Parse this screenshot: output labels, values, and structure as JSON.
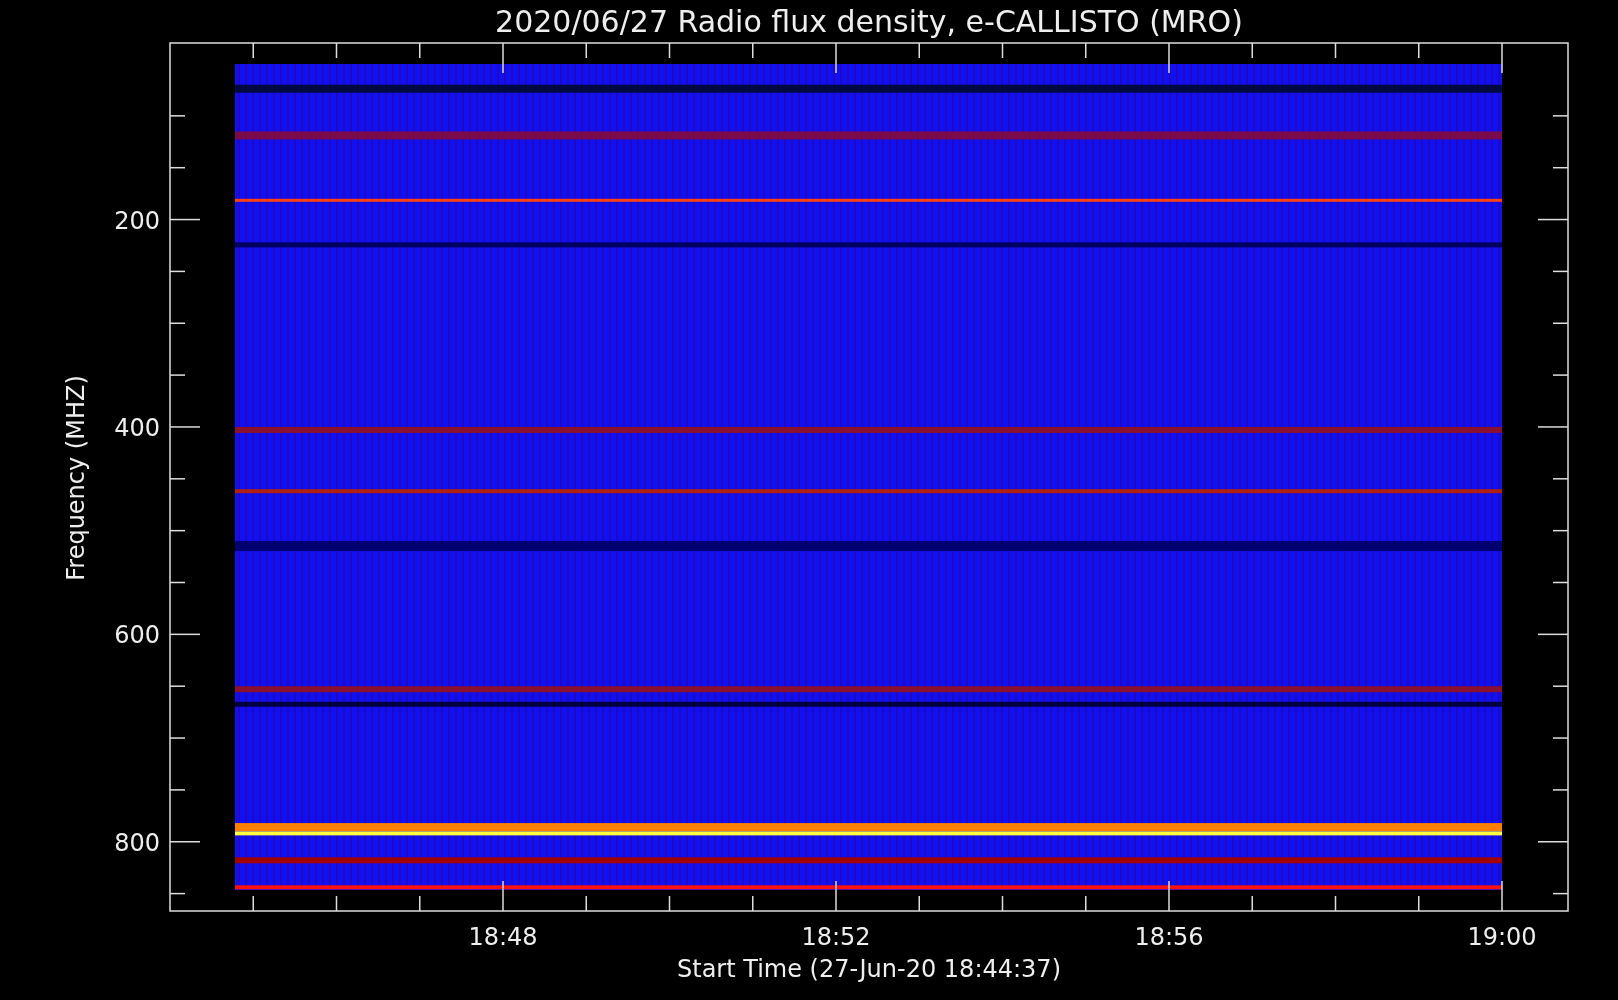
{
  "title": "2020/06/27  Radio flux density, e-CALLISTO (MRO)",
  "y_axis": {
    "label": "Frequency (MHZ)",
    "ticks": [
      "200",
      "400",
      "600",
      "800"
    ]
  },
  "x_axis": {
    "label": "Start Time (27-Jun-20 18:44:37)",
    "ticks": [
      "18:48",
      "18:52",
      "18:56",
      "19:00"
    ]
  }
}
